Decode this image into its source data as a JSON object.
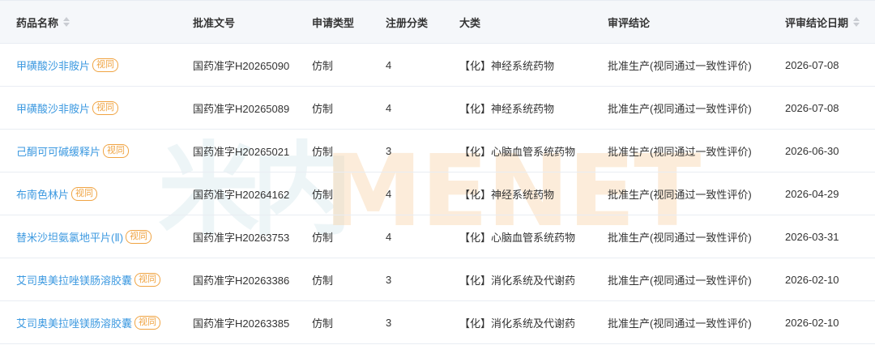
{
  "watermark": {
    "cn": "米内",
    "en": "MENET"
  },
  "headers": {
    "drug_name": "药品名称",
    "approval_no": "批准文号",
    "apply_type": "申请类型",
    "reg_class": "注册分类",
    "category": "大类",
    "conclusion": "审评结论",
    "date": "评审结论日期"
  },
  "badge_label": "视同",
  "rows": [
    {
      "name": "甲磺酸沙非胺片",
      "approval": "国药准字H20265090",
      "type": "仿制",
      "reg": "4",
      "category": "【化】神经系统药物",
      "conclusion": "批准生产(视同通过一致性评价)",
      "date": "2026-07-08"
    },
    {
      "name": "甲磺酸沙非胺片",
      "approval": "国药准字H20265089",
      "type": "仿制",
      "reg": "4",
      "category": "【化】神经系统药物",
      "conclusion": "批准生产(视同通过一致性评价)",
      "date": "2026-07-08"
    },
    {
      "name": "己酮可可碱缓释片",
      "approval": "国药准字H20265021",
      "type": "仿制",
      "reg": "3",
      "category": "【化】心脑血管系统药物",
      "conclusion": "批准生产(视同通过一致性评价)",
      "date": "2026-06-30"
    },
    {
      "name": "布南色林片",
      "approval": "国药准字H20264162",
      "type": "仿制",
      "reg": "4",
      "category": "【化】神经系统药物",
      "conclusion": "批准生产(视同通过一致性评价)",
      "date": "2026-04-29"
    },
    {
      "name": "替米沙坦氨氯地平片(Ⅱ)",
      "approval": "国药准字H20263753",
      "type": "仿制",
      "reg": "4",
      "category": "【化】心脑血管系统药物",
      "conclusion": "批准生产(视同通过一致性评价)",
      "date": "2026-03-31"
    },
    {
      "name": "艾司奥美拉唑镁肠溶胶囊",
      "approval": "国药准字H20263386",
      "type": "仿制",
      "reg": "3",
      "category": "【化】消化系统及代谢药",
      "conclusion": "批准生产(视同通过一致性评价)",
      "date": "2026-02-10"
    },
    {
      "name": "艾司奥美拉唑镁肠溶胶囊",
      "approval": "国药准字H20263385",
      "type": "仿制",
      "reg": "3",
      "category": "【化】消化系统及代谢药",
      "conclusion": "批准生产(视同通过一致性评价)",
      "date": "2026-02-10"
    }
  ]
}
